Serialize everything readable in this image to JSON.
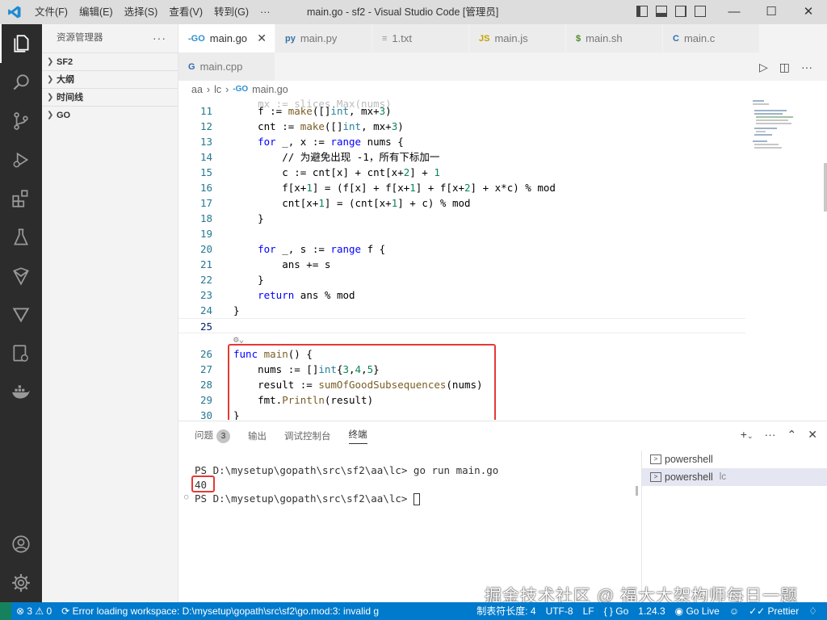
{
  "titlebar": {
    "menu": [
      "文件(F)",
      "编辑(E)",
      "选择(S)",
      "查看(V)",
      "转到(G)",
      "···"
    ],
    "title": "main.go - sf2 - Visual Studio Code [管理员]",
    "minimize": "—",
    "maximize": "☐",
    "close": "✕"
  },
  "sidebar": {
    "title": "资源管理器",
    "more": "···",
    "sections": [
      "SF2",
      "大纲",
      "时间线",
      "GO"
    ]
  },
  "tabs": {
    "row1": [
      {
        "icon": "-GO",
        "label": "main.go",
        "close": "✕"
      },
      {
        "icon": "py",
        "label": "main.py"
      },
      {
        "icon": "≡",
        "label": "1.txt"
      },
      {
        "icon": "JS",
        "label": "main.js"
      },
      {
        "icon": "$",
        "label": "main.sh"
      },
      {
        "icon": "C",
        "label": "main.c"
      }
    ],
    "row2": [
      {
        "icon": "G",
        "label": "main.cpp"
      }
    ]
  },
  "breadcrumb": [
    "aa",
    "lc",
    "main.go"
  ],
  "editor": {
    "lines": [
      {
        "n": "11",
        "code": "    f := make([]int, mx+3)"
      },
      {
        "n": "12",
        "code": "    cnt := make([]int, mx+3)"
      },
      {
        "n": "13",
        "code": "    for _, x := range nums {"
      },
      {
        "n": "14",
        "code": "        // 为避免出现 -1，所有下标加一"
      },
      {
        "n": "15",
        "code": "        c := cnt[x] + cnt[x+2] + 1"
      },
      {
        "n": "16",
        "code": "        f[x+1] = (f[x] + f[x+1] + f[x+2] + x*c) % mod"
      },
      {
        "n": "17",
        "code": "        cnt[x+1] = (cnt[x+1] + c) % mod"
      },
      {
        "n": "18",
        "code": "    }"
      },
      {
        "n": "19",
        "code": ""
      },
      {
        "n": "20",
        "code": "    for _, s := range f {"
      },
      {
        "n": "21",
        "code": "        ans += s"
      },
      {
        "n": "22",
        "code": "    }"
      },
      {
        "n": "23",
        "code": "    return ans % mod"
      },
      {
        "n": "24",
        "code": "}"
      },
      {
        "n": "25",
        "code": ""
      },
      {
        "n": "26",
        "code": "func main() {"
      },
      {
        "n": "27",
        "code": "    nums := []int{3,4,5}"
      },
      {
        "n": "28",
        "code": "    result := sumOfGoodSubsequences(nums)"
      },
      {
        "n": "29",
        "code": "    fmt.Println(result)"
      },
      {
        "n": "30",
        "code": "}"
      }
    ]
  },
  "panel": {
    "tabs": [
      "问题",
      "输出",
      "调试控制台",
      "终端"
    ],
    "problems_count": "3",
    "terminal_lines": [
      "PS D:\\mysetup\\gopath\\src\\sf2\\aa\\lc> go run main.go",
      "40",
      "PS D:\\mysetup\\gopath\\src\\sf2\\aa\\lc> "
    ],
    "terminals": [
      {
        "label": "powershell",
        "sub": ""
      },
      {
        "label": "powershell",
        "sub": "lc"
      }
    ]
  },
  "watermark": "掘金技术社区 @ 福大大架构师每日一题",
  "statusbar": {
    "errors": "⊗ 3 ⚠ 0",
    "workspace_error": "Error loading workspace: D:\\mysetup\\gopath\\src\\sf2\\go.mod:3: invalid g",
    "tab_size": "制表符长度: 4",
    "encoding": "UTF-8",
    "eol": "LF",
    "language": "{ } Go",
    "go_version": "1.24.3",
    "go_live": "Go Live",
    "prettier": "Prettier"
  },
  "colors": {
    "activitybar": "#2c2c2c",
    "statusbar": "#007acc",
    "highlight_box": "#e53935"
  }
}
